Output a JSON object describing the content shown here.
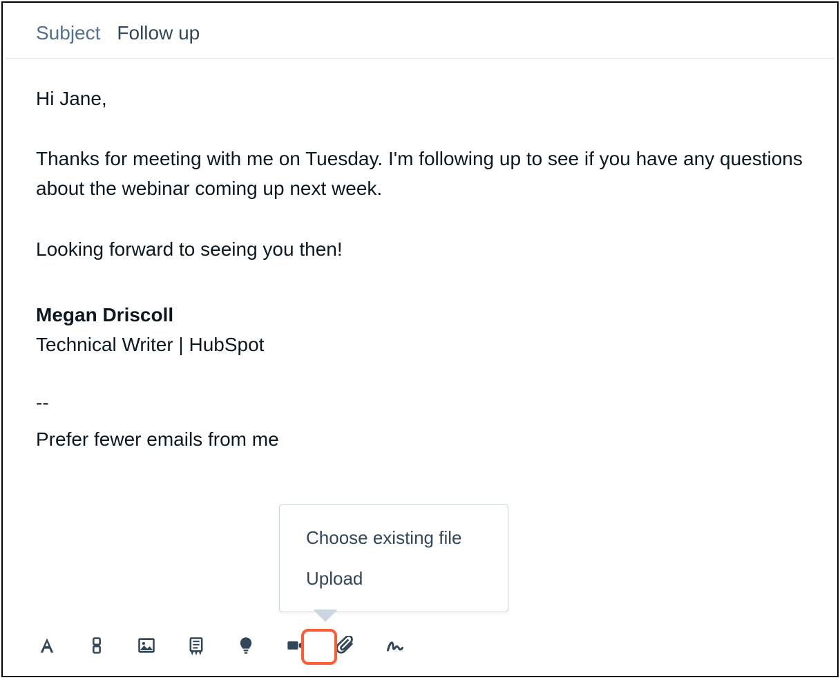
{
  "subject": {
    "label": "Subject",
    "value": "Follow up"
  },
  "body": {
    "greeting": "Hi Jane,",
    "para1": "Thanks for meeting with me on Tuesday. I'm following up to see if you have any questions about the webinar coming up next week.",
    "para2": "Looking forward to seeing you then!",
    "sig_name": "Megan Driscoll",
    "sig_title": "Technical Writer | HubSpot",
    "separator": "--",
    "prefer_text": "Prefer fewer emails from me"
  },
  "popover": {
    "choose_existing": "Choose existing file",
    "upload": "Upload"
  },
  "toolbar": {
    "text_format": "text-format",
    "personalize": "personalize-token",
    "image": "insert-image",
    "snippet": "insert-snippet",
    "knowledge": "knowledge-article",
    "video": "insert-video",
    "attachment": "attach-file",
    "signature": "insert-signature"
  }
}
